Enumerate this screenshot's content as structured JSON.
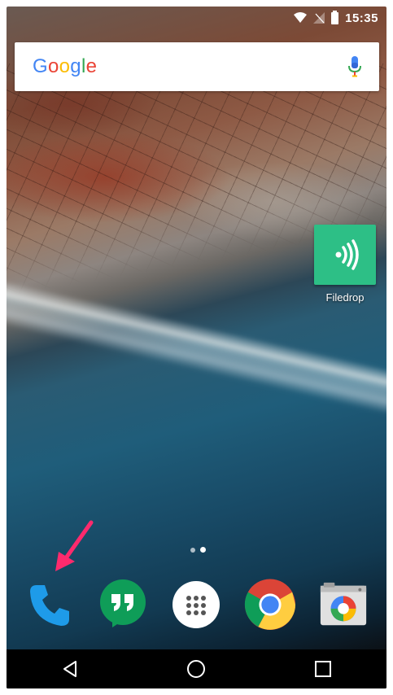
{
  "status_bar": {
    "time": "15:35"
  },
  "search": {
    "logo_text": "Google",
    "logo_colors": [
      "#4285F4",
      "#EA4335",
      "#FBBC05",
      "#4285F4",
      "#34A853",
      "#EA4335"
    ],
    "mic_icon": "mic-icon"
  },
  "apps": [
    {
      "label": "Filedrop",
      "icon": "filedrop-icon",
      "color": "#2dbf86"
    }
  ],
  "page_indicator": {
    "pages": 2,
    "current": 2
  },
  "dock": [
    {
      "name": "phone",
      "icon": "phone-icon",
      "color": "#1e9be9"
    },
    {
      "name": "hangouts",
      "icon": "hangouts-icon",
      "color": "#0f9d58"
    },
    {
      "name": "app-drawer",
      "icon": "app-drawer-icon",
      "color": "#ffffff"
    },
    {
      "name": "chrome",
      "icon": "chrome-icon",
      "color": "#4285F4"
    },
    {
      "name": "camera",
      "icon": "camera-icon",
      "color": "#e0e0e0"
    }
  ],
  "annotation": {
    "icon": "arrow-icon",
    "color": "#ff2a6d"
  },
  "nav": [
    {
      "name": "back",
      "icon": "back-icon"
    },
    {
      "name": "home",
      "icon": "home-icon"
    },
    {
      "name": "recents",
      "icon": "recents-icon"
    }
  ]
}
